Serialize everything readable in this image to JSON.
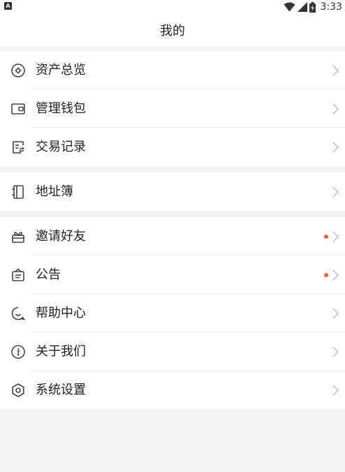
{
  "status_bar": {
    "notification_icon": "A",
    "time": "3:33",
    "icons": [
      "wifi-icon",
      "signal-icon",
      "battery-icon"
    ]
  },
  "header": {
    "title": "我的"
  },
  "groups": [
    {
      "items": [
        {
          "label": "资产总览",
          "icon": "asset-overview-icon"
        },
        {
          "label": "管理钱包",
          "icon": "wallet-icon"
        },
        {
          "label": "交易记录",
          "icon": "transaction-record-icon"
        }
      ]
    },
    {
      "items": [
        {
          "label": "地址簿",
          "icon": "address-book-icon"
        }
      ]
    },
    {
      "items": [
        {
          "label": "邀请好友",
          "icon": "gift-icon",
          "badge_dot": true
        },
        {
          "label": "公告",
          "icon": "announcement-icon",
          "badge_dot": true
        },
        {
          "label": "帮助中心",
          "icon": "help-icon"
        },
        {
          "label": "关于我们",
          "icon": "info-icon"
        },
        {
          "label": "系统设置",
          "icon": "settings-icon"
        }
      ]
    }
  ],
  "colors": {
    "badge_dot": "#f06030",
    "background": "#f4f4f4",
    "icon": "#444444"
  }
}
